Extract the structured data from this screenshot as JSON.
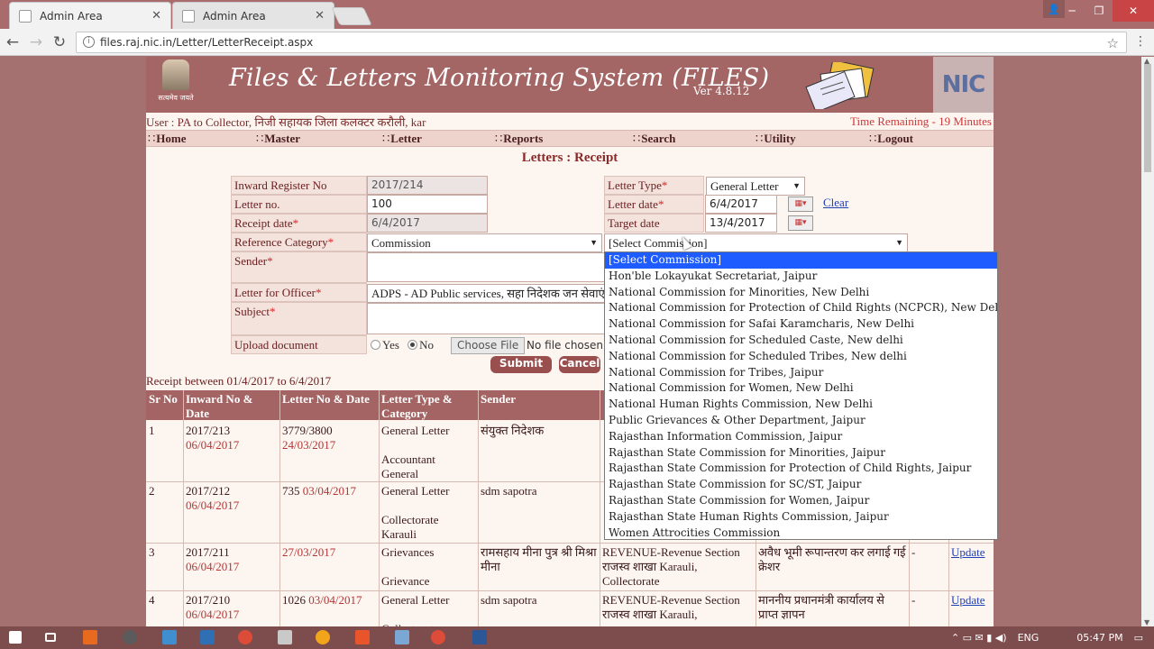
{
  "browser": {
    "tabs": [
      {
        "title": "Admin Area",
        "active": true
      },
      {
        "title": "Admin Area",
        "active": false
      }
    ],
    "url": "files.raj.nic.in/Letter/LetterReceipt.aspx"
  },
  "header": {
    "title": "Files & Letters Monitoring System (FILES)",
    "version": "Ver 4.8.12",
    "emblem_motto": "सत्यमेव जयते",
    "nic": "NIC"
  },
  "userbar": {
    "user": "User : PA to Collector, निजी सहायक जिला कलक्टर करौली, kar",
    "time_remaining": "Time Remaining - 19 Minutes"
  },
  "menu": [
    "Home",
    "Master",
    "Letter",
    "Reports",
    "Search",
    "Utility",
    "Logout"
  ],
  "section_title": "Letters : Receipt",
  "form": {
    "inward_register_label": "Inward Register No",
    "inward_register_value": "2017/214",
    "letter_no_label": "Letter no.",
    "letter_no_value": "100",
    "receipt_date_label": "Receipt date",
    "receipt_date_value": "6/4/2017",
    "reference_category_label": "Reference Category",
    "reference_category_value": "Commission",
    "sender_label": "Sender",
    "letter_for_officer_label": "Letter for Officer",
    "letter_for_officer_value": "ADPS - AD Public services, सहा निदेशक जन सेवाएं",
    "subject_label": "Subject",
    "upload_label": "Upload document",
    "yes_label": "Yes",
    "no_label": "No",
    "choose_file": "Choose File",
    "no_file": "No file chosen",
    "letter_type_label": "Letter Type",
    "letter_type_value": "General Letter",
    "letter_date_label": "Letter date",
    "letter_date_value": "6/4/2017",
    "clear_link": "Clear",
    "target_date_label": "Target date",
    "target_date_value": "13/4/2017",
    "commission_select_value": "[Select Commission]",
    "submit": "Submit",
    "cancel": "Cancel",
    "required_mark": "*"
  },
  "commission_options": [
    "[Select Commission]",
    "Hon'ble Lokayukat Secretariat, Jaipur",
    "National Commission for Minorities, New Delhi",
    "National Commission for Protection of Child Rights (NCPCR), New Delhi",
    "National Commission for Safai Karamcharis, New Delhi",
    "National Commission for Scheduled Caste, New delhi",
    "National Commission for Scheduled Tribes, New delhi",
    "National Commission for Tribes, Jaipur",
    "National Commission for Women, New Delhi",
    "National Human Rights Commission, New Delhi",
    "Public Grievances & Other Department, Jaipur",
    "Rajasthan Information Commission, Jaipur",
    "Rajasthan State Commission for Minorities, Jaipur",
    "Rajasthan State Commission for Protection of Child Rights, Jaipur",
    "Rajasthan State Commission for SC/ST, Jaipur",
    "Rajasthan State Commission for Women, Jaipur",
    "Rajasthan State Human Rights Commission, Jaipur",
    "Women Attrocities Commission"
  ],
  "table": {
    "range": "Receipt between 01/4/2017 to 6/4/2017",
    "headers": [
      "Sr No",
      "Inward No & Date",
      "Letter No & Date",
      "Letter Type & Category",
      "Sender"
    ],
    "update_label": "Update",
    "rows": [
      {
        "sr": "1",
        "inward": "2017/213",
        "inward_date": "06/04/2017",
        "letter_no": "3779/3800",
        "letter_date": "24/03/2017",
        "type": "General Letter",
        "category": "Accountant General",
        "sender": "संयुक्त निदेशक",
        "officer": "",
        "subject": "",
        "status": "",
        "update": false
      },
      {
        "sr": "2",
        "inward": "2017/212",
        "inward_date": "06/04/2017",
        "letter_no": "735",
        "letter_date": "03/04/2017",
        "type": "General Letter",
        "category": "Collectorate Karauli",
        "sender": "sdm sapotra",
        "officer": "",
        "subject": "",
        "status": "",
        "update": false
      },
      {
        "sr": "3",
        "inward": "2017/211",
        "inward_date": "06/04/2017",
        "letter_no": "",
        "letter_date": "27/03/2017",
        "type": "Grievances",
        "category": "Grievance",
        "sender": "रामसहाय मीना पुत्र श्री मिश्रा मीना",
        "officer": "REVENUE-Revenue Section राजस्व शाखा Karauli, Collectorate",
        "subject": "अवैध भूमी रूपान्तरण कर लगाई गई क्रेशर",
        "status": "-",
        "update": true
      },
      {
        "sr": "4",
        "inward": "2017/210",
        "inward_date": "06/04/2017",
        "letter_no": "1026",
        "letter_date": "03/04/2017",
        "type": "General Letter",
        "category": "Collectorate",
        "sender": "sdm sapotra",
        "officer": "REVENUE-Revenue Section राजस्व शाखा Karauli,",
        "subject": "माननीय प्रधानमंत्री कार्यालय से प्राप्त ज्ञापन",
        "status": "-",
        "update": true
      }
    ]
  },
  "taskbar": {
    "lang": "ENG",
    "time": "05:47 PM"
  }
}
